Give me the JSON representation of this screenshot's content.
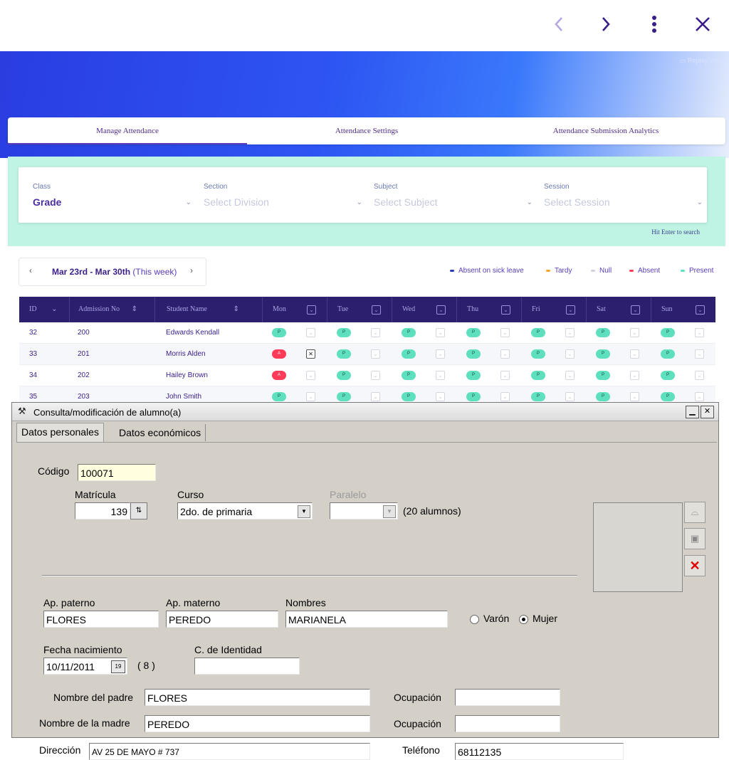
{
  "browser": {
    "prev_icon": "chevron-left-icon",
    "next_icon": "chevron-right-icon",
    "menu_icon": "more-vertical-icon",
    "close_icon": "close-icon"
  },
  "banner": {
    "replay": "Replay video"
  },
  "tabs": [
    "Manage Attendance",
    "Attendance Settings",
    "Attendance Submission Analytics"
  ],
  "filters": [
    {
      "label": "Class",
      "value": "Grade"
    },
    {
      "label": "Section",
      "value": "Select Division"
    },
    {
      "label": "Subject",
      "value": "Select Subject"
    },
    {
      "label": "Session",
      "value": "Select Session"
    }
  ],
  "hit_enter": "Hit Enter to search",
  "week": {
    "prev": "‹",
    "range": "Mar 23rd - Mar 30th",
    "note": " (This week)",
    "next": "›"
  },
  "legend": [
    {
      "label": "Absent on sick leave",
      "color": "#2b3bb8"
    },
    {
      "label": "Tardy",
      "color": "#f5a623"
    },
    {
      "label": "Null",
      "color": "#cfd2dc"
    },
    {
      "label": "Absent",
      "color": "#ff3b58"
    },
    {
      "label": "Present",
      "color": "#5ee0bf"
    }
  ],
  "table": {
    "headers": {
      "id": "ID",
      "admission": "Admission No",
      "student": "Student Name"
    },
    "days": [
      "Mon",
      "Tue",
      "Wed",
      "Thu",
      "Fri",
      "Sat",
      "Sun"
    ],
    "rows": [
      {
        "id": "32",
        "adm": "200",
        "name": "Edwards Kendall",
        "days": [
          "P",
          "P",
          "P",
          "P",
          "P",
          "P",
          "P"
        ]
      },
      {
        "id": "33",
        "adm": "201",
        "name": "Morris Alden",
        "days": [
          "A",
          "P",
          "P",
          "P",
          "P",
          "P",
          "P"
        ]
      },
      {
        "id": "34",
        "adm": "202",
        "name": "Hailey Brown",
        "days": [
          "A",
          "P",
          "P",
          "P",
          "P",
          "P",
          "P"
        ]
      },
      {
        "id": "35",
        "adm": "203",
        "name": "John Smith",
        "days": [
          "P",
          "P",
          "P",
          "P",
          "P",
          "P",
          "P"
        ]
      }
    ]
  },
  "dialog": {
    "title": "Consulta/modificación de alumno(a)",
    "tabs": [
      "Datos personales",
      "Datos económicos"
    ],
    "codigo_label": "Código",
    "codigo": "100071",
    "matricula_label": "Matrícula",
    "matricula": "139",
    "curso_label": "Curso",
    "curso": "2do. de primaria",
    "paralelo_label": "Paralelo",
    "paralelo": "",
    "alumnos": "(20 alumnos)",
    "ap_paterno_label": "Ap. paterno",
    "ap_paterno": "FLORES",
    "ap_materno_label": "Ap. materno",
    "ap_materno": "PEREDO",
    "nombres_label": "Nombres",
    "nombres": "MARIANELA",
    "varon": "Varón",
    "mujer": "Mujer",
    "fecha_label": "Fecha nacimiento",
    "fecha": "10/11/2011",
    "edad": "( 8 )",
    "ci_label": "C. de Identidad",
    "ci": "",
    "padre_label": "Nombre del padre",
    "padre": "FLORES",
    "madre_label": "Nombre de la madre",
    "madre": "PEREDO",
    "ocupacion_label": "Ocupación",
    "ocupacion_padre": "",
    "ocupacion_madre": "",
    "direccion_label": "Dirección",
    "direccion": "AV 25 DE MAYO # 737",
    "telefono_label": "Teléfono",
    "telefono": "68112135"
  }
}
